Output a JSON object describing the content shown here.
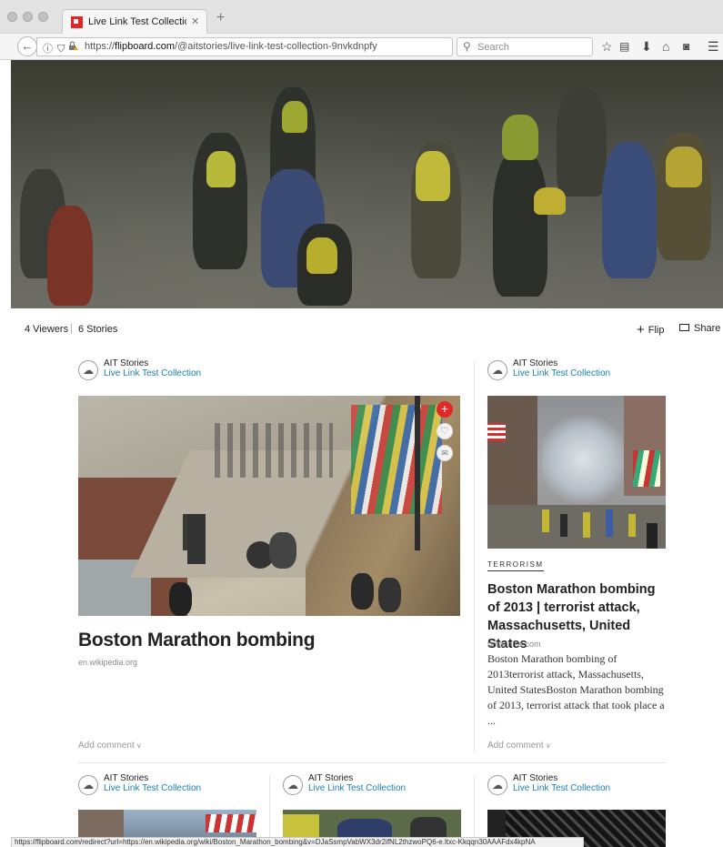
{
  "browser": {
    "tab_title": "Live Link Test Collection on F",
    "tab_close": "✕",
    "new_tab": "+",
    "url_prefix": "https://",
    "url_host": "flipboard.com",
    "url_path": "/@aitstories/live-link-test-collection-9nvkdnpfy",
    "search_placeholder": "Search",
    "status_url": "https://flipboard.com/redirect?url=https://en.wikipedia.org/wiki/Boston_Marathon_bombing&v=DJaSsmpVabWX3dr2ifNL2thzwoPQ6-e.ltxc-Kkqqn30AAAFdx4kpNA"
  },
  "stats": {
    "viewers": "4 Viewers",
    "separator": "|",
    "stories": "6 Stories",
    "flip_label": "Flip",
    "share_label": "Share"
  },
  "cards": [
    {
      "author": "AIT Stories",
      "collection": "Live Link Test Collection",
      "title": "Boston Marathon bombing",
      "source": "en.wikipedia.org",
      "add_comment": "Add comment"
    },
    {
      "author": "AIT Stories",
      "collection": "Live Link Test Collection",
      "tag": "TERRORISM",
      "title": "Boston Marathon bombing of 2013 | terrorist attack, Massachusetts, United States",
      "source": "britannica.com",
      "excerpt": "Boston Marathon bombing of 2013terrorist attack, Massachusetts, United StatesBoston Marathon bombing of 2013, terrorist attack that took place a ...",
      "add_comment": "Add comment"
    },
    {
      "author": "AIT Stories",
      "collection": "Live Link Test Collection"
    },
    {
      "author": "AIT Stories",
      "collection": "Live Link Test Collection"
    },
    {
      "author": "AIT Stories",
      "collection": "Live Link Test Collection"
    }
  ],
  "colors": {
    "accent_link": "#1a7fb5",
    "flip_red": "#e12828"
  },
  "icons": [
    "back-arrow-icon",
    "info-icon",
    "shield-icon",
    "lock-warning-icon",
    "reload-icon",
    "search-icon",
    "star-icon",
    "reading-list-icon",
    "download-icon",
    "home-icon",
    "pocket-icon",
    "menu-icon",
    "plus-icon",
    "heart-icon",
    "mail-icon",
    "avatar-cloud-icon"
  ]
}
